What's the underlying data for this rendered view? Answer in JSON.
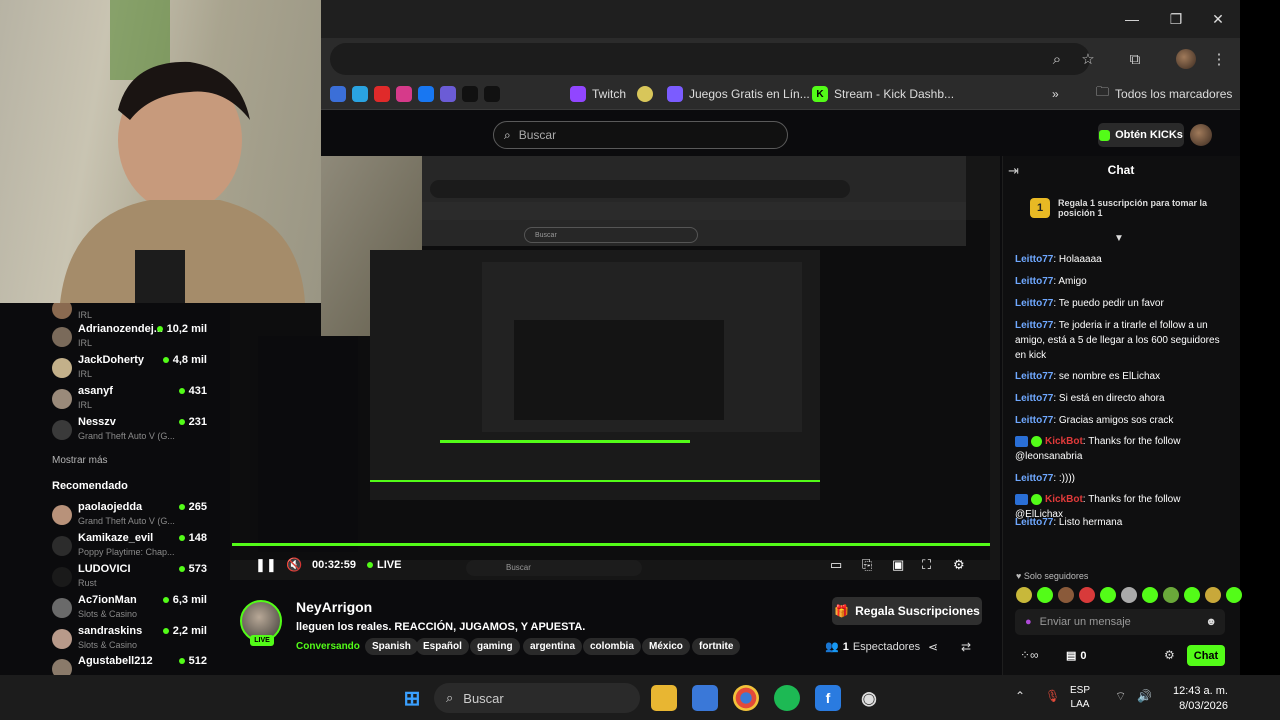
{
  "window": {
    "minimize_icon": "minimize-icon",
    "maximize_icon": "restore-icon",
    "close_icon": "close-icon",
    "close_glyph": "✕",
    "min_glyph": "—",
    "max_glyph": "❐"
  },
  "bookmarks": {
    "items": [
      {
        "label": "Twitch",
        "color": "#9146ff",
        "glyph": "t"
      },
      {
        "label": "Juegos Gratis en Lín...",
        "color": "#7b5cff",
        "glyph": "J"
      },
      {
        "label": "Stream - Kick Dashb...",
        "color": "#53fc18",
        "glyph": "K"
      }
    ],
    "all_bookmarks_label": "Todos los marcadores",
    "overflow_glyph": "»"
  },
  "header": {
    "search_placeholder": "Buscar",
    "get_kicks_label": "Obtén KICKs"
  },
  "sidebar": {
    "channels": [
      {
        "name": "",
        "category": "IRL",
        "viewers": ""
      },
      {
        "name": "Adrianozendej...",
        "category": "IRL",
        "viewers": "10,2 mil"
      },
      {
        "name": "JackDoherty",
        "category": "IRL",
        "viewers": "4,8 mil"
      },
      {
        "name": "asanyf",
        "category": "IRL",
        "viewers": "431"
      },
      {
        "name": "Nesszv",
        "category": "Grand Theft Auto V (G...",
        "viewers": "231"
      }
    ],
    "show_more_label": "Mostrar más",
    "recommended_heading": "Recomendado",
    "recommended": [
      {
        "name": "paolaojedda",
        "category": "Grand Theft Auto V (G...",
        "viewers": "265"
      },
      {
        "name": "Kamikaze_evil",
        "category": "Poppy Playtime: Chap...",
        "viewers": "148"
      },
      {
        "name": "LUDOVICI",
        "category": "Rust",
        "viewers": "573"
      },
      {
        "name": "Ac7ionMan",
        "category": "Slots & Casino",
        "viewers": "6,3 mil"
      },
      {
        "name": "sandraskins",
        "category": "Slots & Casino",
        "viewers": "2,2 mil"
      },
      {
        "name": "Agustabell212",
        "category": "",
        "viewers": "512"
      }
    ]
  },
  "player": {
    "time": "00:32:59",
    "live_label": "LIVE",
    "nested_search": "Buscar",
    "nested_taskbar_search": "Buscar"
  },
  "stream": {
    "streamer_name": "NeyArrigon",
    "live_badge": "LIVE",
    "title": "lleguen los reales. REACCIÓN, JUGAMOS, Y APUESTA.",
    "category": "Conversando",
    "tags": [
      "Spanish",
      "Español",
      "gaming",
      "argentina",
      "colombia",
      "México",
      "fortnite"
    ],
    "gift_sub_label": "Regala Suscripciones",
    "viewers_count": "1",
    "viewers_label": "Espectadores"
  },
  "chat": {
    "title": "Chat",
    "pinned_rank": "1",
    "pinned_text": "Regala 1 suscripción para tomar la posición 1",
    "messages": [
      {
        "user": "Leitto77",
        "text": "Holaaaaa"
      },
      {
        "user": "Leitto77",
        "text": "Amigo"
      },
      {
        "user": "Leitto77",
        "text": "Te puedo pedir un favor"
      },
      {
        "user": "Leitto77",
        "text": "Te joderia ir a tirarle el follow a un amigo, está a 5 de llegar a los 600 seguidores en kick"
      },
      {
        "user": "Leitto77",
        "text": "se nombre es ElLichax"
      },
      {
        "user": "Leitto77",
        "text": "Si está en directo ahora"
      },
      {
        "user": "Leitto77",
        "text": "Gracias amigos sos crack"
      },
      {
        "user": "KickBot",
        "text": "Thanks for the follow @leonsanabria"
      },
      {
        "user": "Leitto77",
        "text": ":))))"
      },
      {
        "user": "KickBot",
        "text": "Thanks for the follow @ElLichax"
      },
      {
        "user": "Leitto77",
        "text": "Listo hermana"
      }
    ],
    "followers_only": "Solo seguidores",
    "input_placeholder": "Enviar un mensaje",
    "kicks_count": "0",
    "send_label": "Chat"
  },
  "taskbar": {
    "search_label": "Buscar",
    "lang_line1": "ESP",
    "lang_line2": "LAA",
    "time": "12:43 a. m.",
    "date": "8/03/2026"
  },
  "colors": {
    "kick_green": "#53fc18",
    "username_blue": "#6fa8ff",
    "bot_red": "#e23a3a"
  }
}
